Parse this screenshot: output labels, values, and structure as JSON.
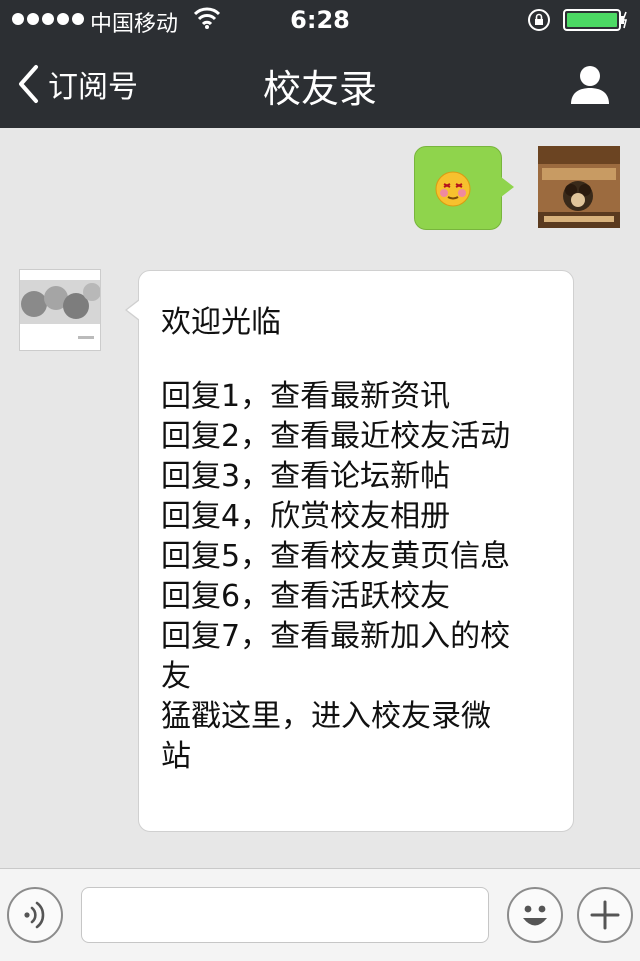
{
  "status_bar": {
    "carrier": "中国移动",
    "time": "6:28"
  },
  "nav": {
    "back_label": "订阅号",
    "title": "校友录"
  },
  "messages": {
    "outgoing": {
      "type": "emoji",
      "emoji": "flushed-face-icon"
    },
    "incoming": {
      "title": "欢迎光临",
      "lines": [
        "回复1，查看最新资讯",
        "回复2，查看最近校友活动",
        "回复3，查看论坛新帖",
        "回复4，欣赏校友相册",
        "回复5，查看校友黄页信息",
        "回复6，查看活跃校友",
        "回复7，查看最新加入的校",
        "友",
        "猛戳这里，进入校友录微",
        "站"
      ]
    }
  },
  "input_bar": {
    "text_value": ""
  },
  "icons": {
    "signal": "signal-dots-icon",
    "wifi": "wifi-icon",
    "lock": "rotation-lock-icon",
    "battery": "battery-icon",
    "back": "chevron-left-icon",
    "profile": "person-icon",
    "voice": "voice-icon",
    "smile": "smiley-icon",
    "plus": "plus-icon"
  },
  "colors": {
    "nav_bg": "#2c2f33",
    "chat_bg": "#e7e7e7",
    "outgoing_bubble": "#8fd44c",
    "incoming_bubble": "#ffffff",
    "battery": "#4cd964"
  }
}
